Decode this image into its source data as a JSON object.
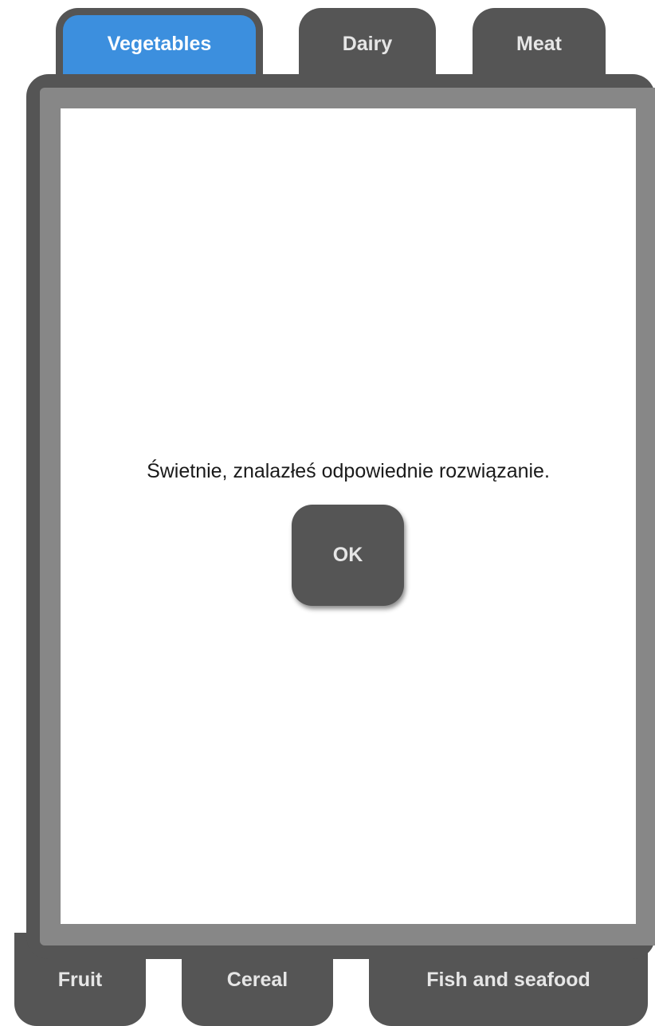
{
  "top_tabs": [
    {
      "label": "Vegetables",
      "active": true
    },
    {
      "label": "Dairy",
      "active": false
    },
    {
      "label": "Meat",
      "active": false
    }
  ],
  "bottom_tabs": [
    {
      "label": "Fruit"
    },
    {
      "label": "Cereal"
    },
    {
      "label": "Fish and seafood"
    }
  ],
  "dialog": {
    "message": "Świetnie, znalazłeś odpowiednie rozwiązanie.",
    "ok_label": "OK"
  },
  "colors": {
    "active_tab": "#3c8fde",
    "tab": "#555555",
    "panel_frame": "#555555",
    "panel_inner": "#878787",
    "content_bg": "#ffffff"
  }
}
